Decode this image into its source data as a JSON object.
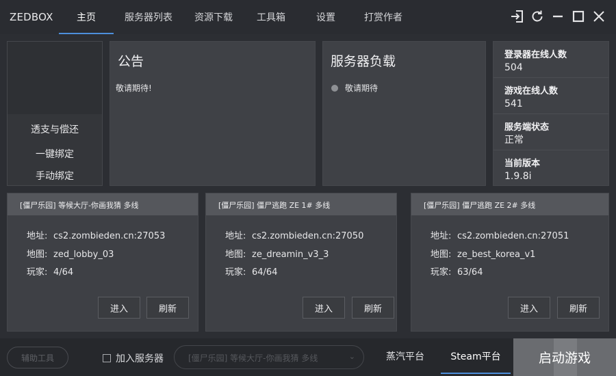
{
  "app": {
    "brand": "ZEDBOX"
  },
  "nav": [
    "主页",
    "服务器列表",
    "资源下载",
    "工具箱",
    "设置",
    "打赏作者"
  ],
  "nav_active_index": 0,
  "window_controls": [
    "login-exit-icon",
    "refresh-icon",
    "minimize-icon",
    "maximize-icon",
    "close-icon"
  ],
  "side_actions": [
    "透支与偿还",
    "一键绑定",
    "手动绑定"
  ],
  "notice": {
    "title": "公告",
    "body": "敬请期待!"
  },
  "server_load": {
    "title": "服务器负载",
    "status": "敬请期待",
    "status_dot_color": "#8e9094"
  },
  "stats": [
    {
      "label": "登录器在线人数",
      "value": "504"
    },
    {
      "label": "游戏在线人数",
      "value": "541"
    },
    {
      "label": "服务端状态",
      "value": "正常"
    },
    {
      "label": "当前版本",
      "value": "1.9.8i"
    }
  ],
  "server_field_labels": {
    "address": "地址:",
    "map": "地图:",
    "players": "玩家:"
  },
  "server_buttons": {
    "enter": "进入",
    "refresh": "刷新"
  },
  "servers": [
    {
      "title": "[僵尸乐园] 等候大厅-你画我猜 多线",
      "address": "cs2.zombieden.cn:27053",
      "map": "zed_lobby_03",
      "players": "4/64"
    },
    {
      "title": "[僵尸乐园] 僵尸逃跑 ZE 1# 多线",
      "address": "cs2.zombieden.cn:27050",
      "map": "ze_dreamin_v3_3",
      "players": "64/64"
    },
    {
      "title": "[僵尸乐园] 僵尸逃跑 ZE 2# 多线",
      "address": "cs2.zombieden.cn:27051",
      "map": "ze_best_korea_v1",
      "players": "63/64"
    }
  ],
  "bottom": {
    "helper_label": "辅助工具",
    "join_server_label": "加入服务器",
    "join_server_checked": false,
    "server_select_value": "[僵尸乐园] 等候大厅-你画我猜 多线",
    "platforms": [
      "蒸汽平台",
      "Steam平台"
    ],
    "platform_active_index": 1,
    "launch_label": "启动游戏"
  },
  "colors": {
    "accent": "#4d8fdc",
    "background": "#2c2e33",
    "panel": "#3f4146",
    "card_header": "#55575c",
    "launch": "#6a6c70"
  }
}
